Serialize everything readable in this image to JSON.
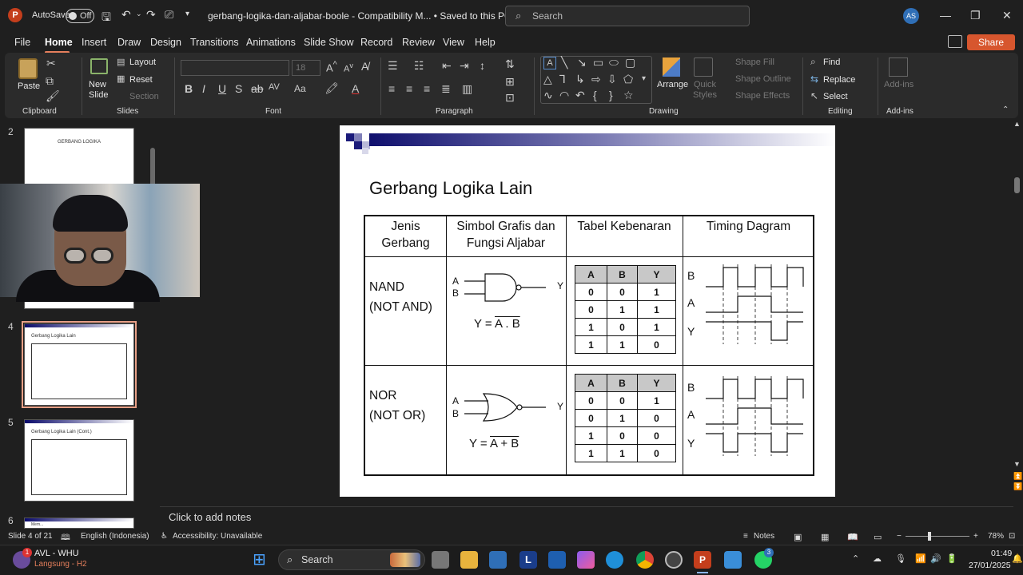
{
  "app": {
    "logo_letter": "P",
    "autosave_label": "AutoSave",
    "autosave_state": "Off",
    "doc_title": "gerbang-logika-dan-aljabar-boole  -  Compatibility M...  •  Saved to this PC",
    "search_placeholder": "Search",
    "user_initials": "AS"
  },
  "menu": {
    "items": [
      "File",
      "Home",
      "Insert",
      "Draw",
      "Design",
      "Transitions",
      "Animations",
      "Slide Show",
      "Record",
      "Review",
      "View",
      "Help"
    ],
    "share_label": "Share"
  },
  "ribbon": {
    "clipboard": {
      "paste": "Paste",
      "label": "Clipboard"
    },
    "slides": {
      "new_slide": "New Slide",
      "layout": "Layout",
      "reset": "Reset",
      "section": "Section",
      "label": "Slides"
    },
    "font": {
      "font_name": "",
      "font_size": "18",
      "label": "Font"
    },
    "paragraph": {
      "label": "Paragraph"
    },
    "drawing": {
      "arrange": "Arrange",
      "quick_styles": "Quick Styles",
      "shape_fill": "Shape Fill",
      "shape_outline": "Shape Outline",
      "shape_effects": "Shape Effects",
      "label": "Drawing"
    },
    "editing": {
      "find": "Find",
      "replace": "Replace",
      "select": "Select",
      "label": "Editing"
    },
    "addins": {
      "addins": "Add-ins",
      "label": "Add-ins"
    }
  },
  "thumbnails": [
    {
      "number": "2",
      "title": "GERBANG LOGIKA"
    },
    {
      "number": "4",
      "title": "Gerbang Logika Lain",
      "selected": true
    },
    {
      "number": "5",
      "title": "Gerbang Logika Lain (Cont.)"
    },
    {
      "number": "6",
      "title": "Mem..."
    }
  ],
  "slide": {
    "title": "Gerbang Logika Lain",
    "headers": [
      "Jenis\nGerbang",
      "Simbol Grafis dan\nFungsi Aljabar",
      "Tabel Kebenaran",
      "Timing Dagram"
    ],
    "rows": [
      {
        "gate": "NAND\n(NOT AND)",
        "input_a": "A",
        "input_b": "B",
        "output": "Y",
        "formula_prefix": "Y = ",
        "formula_overline": "A . B",
        "truth_header": [
          "A",
          "B",
          "Y"
        ],
        "truth": [
          [
            "0",
            "0",
            "1"
          ],
          [
            "0",
            "1",
            "1"
          ],
          [
            "1",
            "0",
            "1"
          ],
          [
            "1",
            "1",
            "0"
          ]
        ],
        "timing_labels": [
          "B",
          "A",
          "Y"
        ]
      },
      {
        "gate": "NOR\n(NOT OR)",
        "input_a": "A",
        "input_b": "B",
        "output": "Y",
        "formula_prefix": "Y = ",
        "formula_overline": "A + B",
        "truth_header": [
          "A",
          "B",
          "Y"
        ],
        "truth": [
          [
            "0",
            "0",
            "1"
          ],
          [
            "0",
            "1",
            "0"
          ],
          [
            "1",
            "0",
            "0"
          ],
          [
            "1",
            "1",
            "0"
          ]
        ],
        "timing_labels": [
          "B",
          "A",
          "Y"
        ]
      }
    ]
  },
  "notes_placeholder": "Click to add notes",
  "status": {
    "slide_info": "Slide 4 of 21",
    "language": "English (Indonesia)",
    "accessibility": "Accessibility: Unavailable",
    "notes": "Notes",
    "zoom": "78%"
  },
  "taskbar": {
    "account_name": "AVL - WHU",
    "account_sub": "Langsung - H2",
    "badge": "1",
    "search": "Search",
    "time": "01:49",
    "date": "27/01/2025",
    "whatsapp_badge": "3"
  }
}
